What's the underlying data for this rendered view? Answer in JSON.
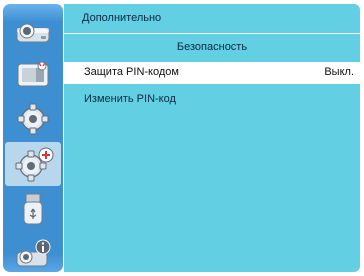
{
  "header": {
    "title": "Дополнительно"
  },
  "section_title": "Безопасность",
  "items": [
    {
      "label": "Защита PIN-кодом",
      "value": "Выкл."
    },
    {
      "label": "Изменить PIN-код"
    }
  ],
  "sidebar": {
    "icons": [
      "projector-icon",
      "image-icon",
      "gear-icon",
      "advanced-gear-icon",
      "usb-icon",
      "projector-info-icon"
    ],
    "active": "advanced-gear-icon"
  },
  "colors": {
    "panel": "#62cfe2",
    "sidebar": "#3e8fd2",
    "highlight_row": "#ffffff"
  }
}
